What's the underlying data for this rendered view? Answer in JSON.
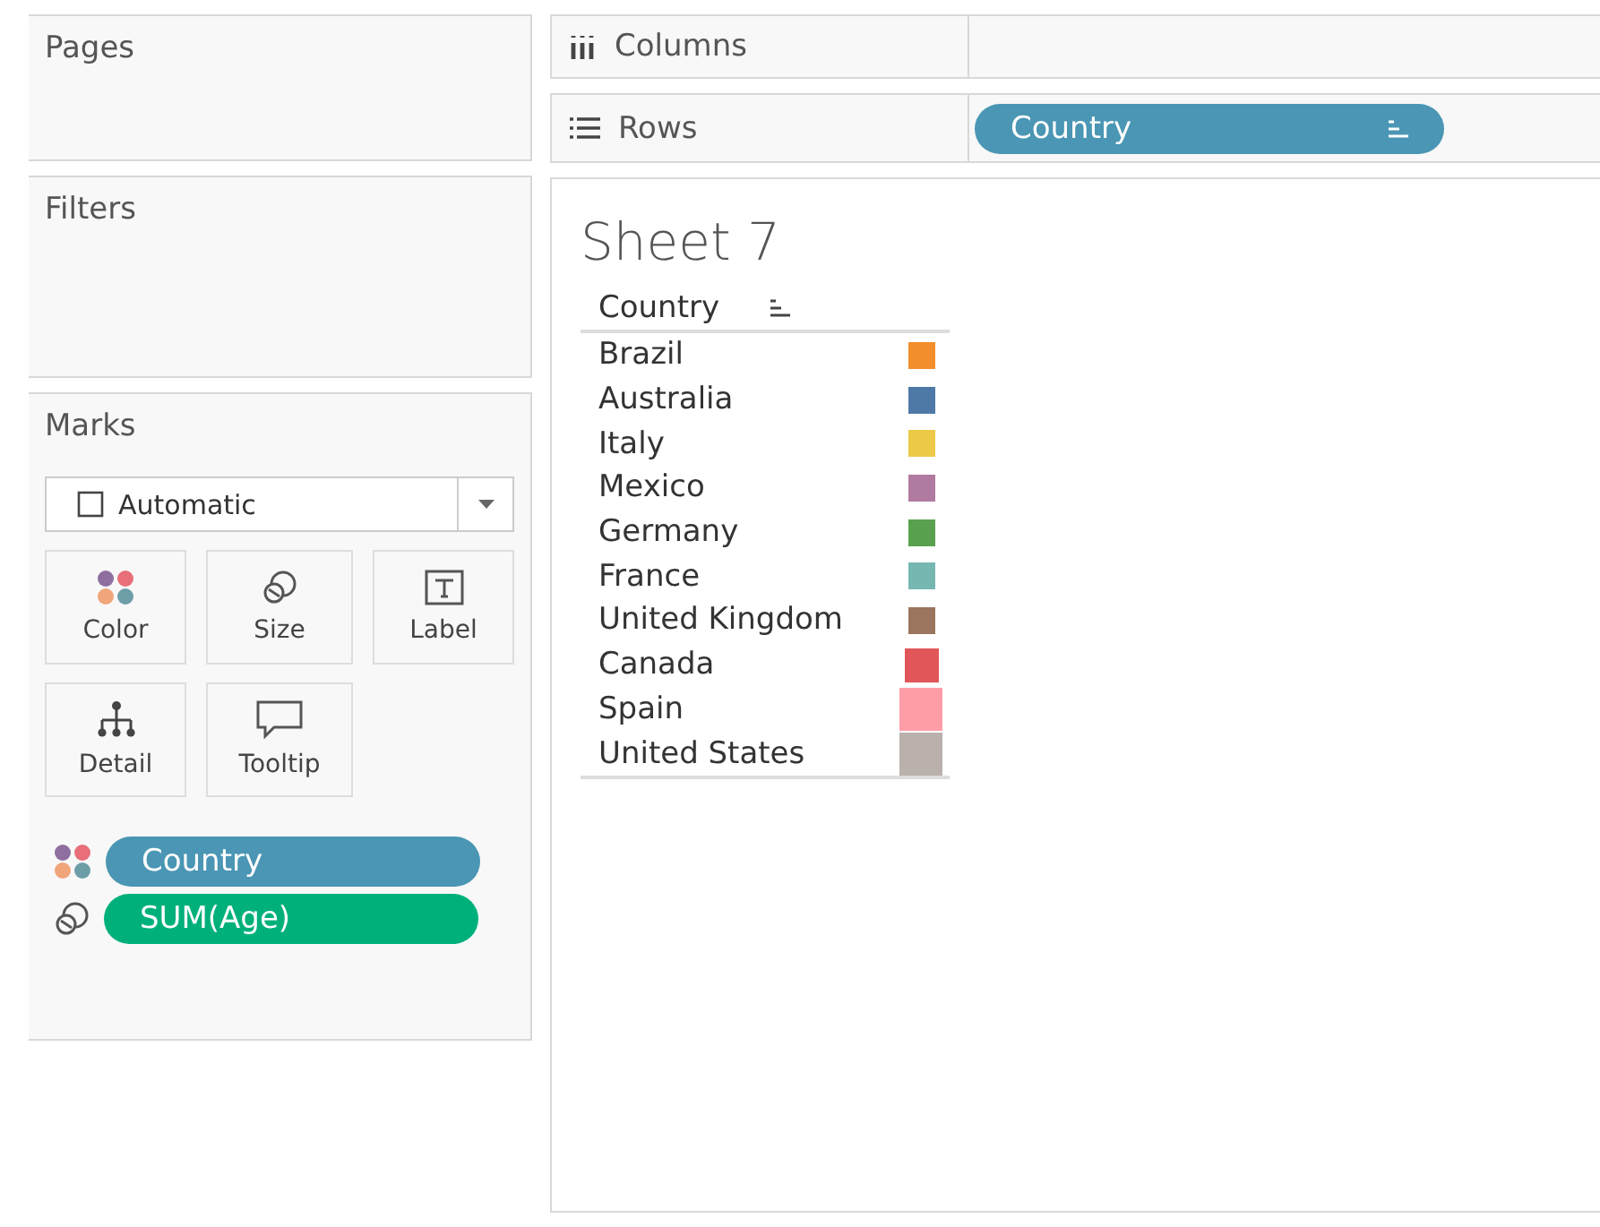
{
  "side_panels": [
    {
      "title": "Pages"
    },
    {
      "title": "Filters"
    }
  ],
  "marks": {
    "title": "Marks",
    "mark_type": "Automatic",
    "cards": [
      {
        "kind": "color",
        "label": "Color"
      },
      {
        "kind": "size",
        "label": "Size"
      },
      {
        "kind": "label",
        "label": "Label"
      },
      {
        "kind": "detail",
        "label": "Detail"
      },
      {
        "kind": "tooltip",
        "label": "Tooltip"
      }
    ],
    "pills": [
      {
        "kind": "color",
        "label": "Country",
        "color": "#4a96b4"
      },
      {
        "kind": "size",
        "label": "SUM(Age)",
        "color": "#00b07b"
      }
    ]
  },
  "shelves": [
    {
      "kind": "columns",
      "label": "Columns"
    },
    {
      "kind": "rows",
      "label": "Rows",
      "pills": [
        {
          "label": "Country",
          "sorted": true
        }
      ]
    }
  ],
  "sheet": {
    "title": "Sheet 7",
    "column_header": "Country",
    "header_sorted": true,
    "rows": [
      {
        "name": "Brazil",
        "color": "#f28e2b",
        "kind": "small"
      },
      {
        "name": "Australia",
        "color": "#4e79a7",
        "kind": "small"
      },
      {
        "name": "Italy",
        "color": "#edc948",
        "kind": "small"
      },
      {
        "name": "Mexico",
        "color": "#b07aa1",
        "kind": "small"
      },
      {
        "name": "Germany",
        "color": "#59a14f",
        "kind": "small"
      },
      {
        "name": "France",
        "color": "#76b7b2",
        "kind": "small"
      },
      {
        "name": "United Kingdom",
        "color": "#9c755f",
        "kind": "small"
      },
      {
        "name": "Canada",
        "color": "#e15759",
        "kind": "medium"
      },
      {
        "name": "Spain",
        "color": "#ff9da7",
        "kind": "large"
      },
      {
        "name": "United States",
        "color": "#bab0ac",
        "kind": "large"
      }
    ]
  }
}
